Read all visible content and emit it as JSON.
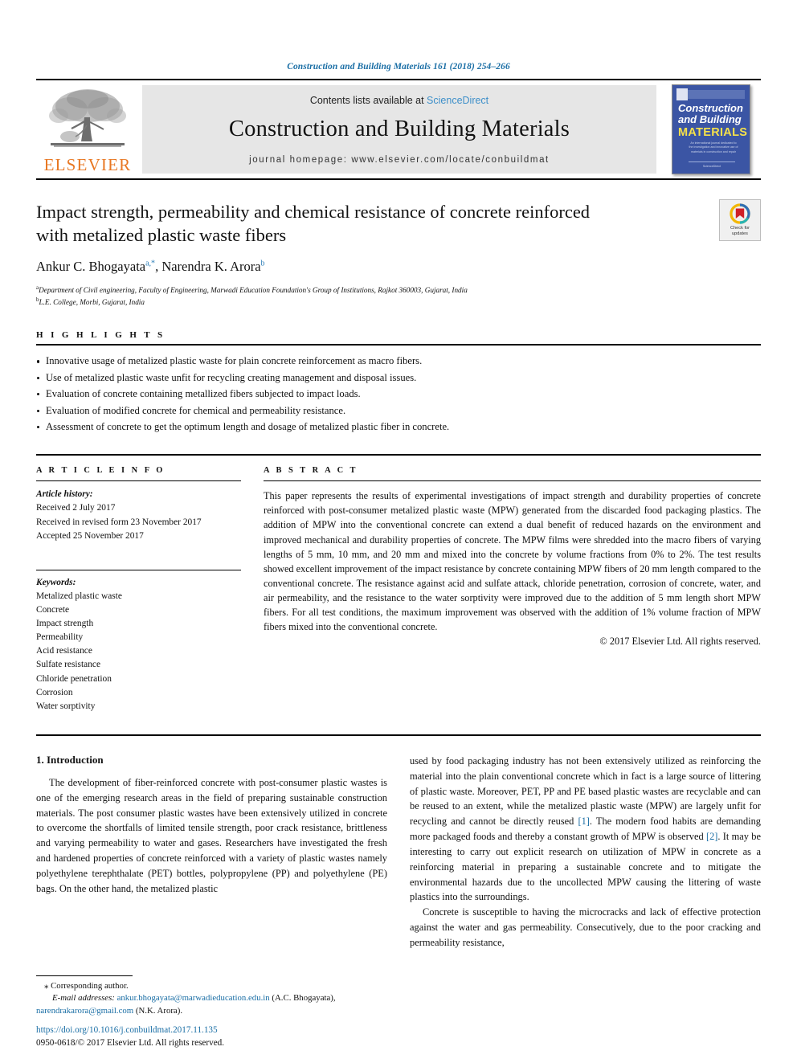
{
  "running_head": "Construction and Building Materials 161 (2018) 254–266",
  "masthead": {
    "publisher_name": "ELSEVIER",
    "contents_prefix": "Contents lists available at ",
    "sciencedirect": "ScienceDirect",
    "journal_title": "Construction and Building Materials",
    "homepage": "journal homepage: www.elsevier.com/locate/conbuildmat",
    "cover": {
      "line1": "Construction",
      "line2": "and Building",
      "line3": "MATERIALS",
      "blurb": "An international journal dedicated to the investigation and innovative use of materials in construction and repair",
      "footer": "ScienceDirect"
    }
  },
  "article": {
    "title": "Impact strength, permeability and chemical resistance of concrete reinforced with metalized plastic waste fibers",
    "authors": [
      {
        "name": "Ankur C. Bhogayata",
        "marks": "a,*"
      },
      {
        "name": "Narendra K. Arora",
        "marks": "b"
      }
    ],
    "authors_separator": ", ",
    "affiliations": [
      {
        "mark": "a",
        "text": "Department of Civil engineering, Faculty of Engineering, Marwadi Education Foundation's Group of Institutions, Rajkot 360003, Gujarat, India"
      },
      {
        "mark": "b",
        "text": "L.E. College, Morbi, Gujarat, India"
      }
    ],
    "crossmark": {
      "line1": "Check for",
      "line2": "updates"
    }
  },
  "highlights": {
    "heading": "H I G H L I G H T S",
    "items": [
      "Innovative usage of metalized plastic waste for plain concrete reinforcement as macro fibers.",
      "Use of metalized plastic waste unfit for recycling creating management and disposal issues.",
      "Evaluation of concrete containing metallized fibers subjected to impact loads.",
      "Evaluation of modified concrete for chemical and permeability resistance.",
      "Assessment of concrete to get the optimum length and dosage of metalized plastic fiber in concrete."
    ]
  },
  "article_info": {
    "heading": "A R T I C L E   I N F O",
    "history_label": "Article history:",
    "history": [
      "Received 2 July 2017",
      "Received in revised form 23 November 2017",
      "Accepted 25 November 2017"
    ],
    "keywords_label": "Keywords:",
    "keywords": [
      "Metalized plastic waste",
      "Concrete",
      "Impact strength",
      "Permeability",
      "Acid resistance",
      "Sulfate resistance",
      "Chloride penetration",
      "Corrosion",
      "Water sorptivity"
    ]
  },
  "abstract": {
    "heading": "A B S T R A C T",
    "text": "This paper represents the results of experimental investigations of impact strength and durability properties of concrete reinforced with post-consumer metalized plastic waste (MPW) generated from the discarded food packaging plastics. The addition of MPW into the conventional concrete can extend a dual benefit of reduced hazards on the environment and improved mechanical and durability properties of concrete. The MPW films were shredded into the macro fibers of varying lengths of 5 mm, 10 mm, and 20 mm and mixed into the concrete by volume fractions from 0% to 2%. The test results showed excellent improvement of the impact resistance by concrete containing MPW fibers of 20 mm length compared to the conventional concrete. The resistance against acid and sulfate attack, chloride penetration, corrosion of concrete, water, and air permeability, and the resistance to the water sorptivity were improved due to the addition of 5 mm length short MPW fibers. For all test conditions, the maximum improvement was observed with the addition of 1% volume fraction of MPW fibers mixed into the conventional concrete.",
    "copyright": "© 2017 Elsevier Ltd. All rights reserved."
  },
  "body": {
    "section_title": "1. Introduction",
    "left_paragraphs": [
      "The development of fiber-reinforced concrete with post-consumer plastic wastes is one of the emerging research areas in the field of preparing sustainable construction materials. The post consumer plastic wastes have been extensively utilized in concrete to overcome the shortfalls of limited tensile strength, poor crack resistance, brittleness and varying permeability to water and gases. Researchers have investigated the fresh and hardened properties of concrete reinforced with a variety of plastic wastes namely polyethylene terephthalate (PET) bottles, polypropylene (PP) and polyethylene (PE) bags. On the other hand, the metalized plastic"
    ],
    "right_paragraph_1_a": "used by food packaging industry has not been extensively utilized as reinforcing the material into the plain conventional concrete which in fact is a large source of littering of plastic waste. Moreover, PET, PP and PE based plastic wastes are recyclable and can be reused to an extent, while the metalized plastic waste (MPW) are largely unfit for recycling and cannot be directly reused ",
    "ref_1": "[1]",
    "right_paragraph_1_b": ". The modern food habits are demanding more packaged foods and thereby a constant growth of MPW is observed ",
    "ref_2": "[2]",
    "right_paragraph_1_c": ". It may be interesting to carry out explicit research on utilization of MPW in concrete as a reinforcing material in preparing a sustainable concrete and to mitigate the environmental hazards due to the uncollected MPW causing the littering of waste plastics into the surroundings.",
    "right_paragraph_2": "Concrete is susceptible to having the microcracks and lack of effective protection against the water and gas permeability. Consecutively, due to the poor cracking and permeability resistance,"
  },
  "footnote": {
    "corresponding": "⁎ Corresponding author.",
    "email_label": "E-mail addresses:",
    "email_1": "ankur.bhogayata@marwadieducation.edu.in",
    "email_1_who": " (A.C. Bhogayata),",
    "email_2": "narendrakarora@gmail.com",
    "email_2_who": " (N.K. Arora)."
  },
  "doi": {
    "url": "https://doi.org/10.1016/j.conbuildmat.2017.11.135",
    "issn_line": "0950-0618/© 2017 Elsevier Ltd. All rights reserved."
  },
  "colors": {
    "link_blue": "#1a6ea5",
    "sciencedirect_blue": "#3d8fc9",
    "elsevier_orange": "#e87722",
    "cover_blue": "#3b55a4",
    "cover_yellow": "#f5e14a"
  }
}
